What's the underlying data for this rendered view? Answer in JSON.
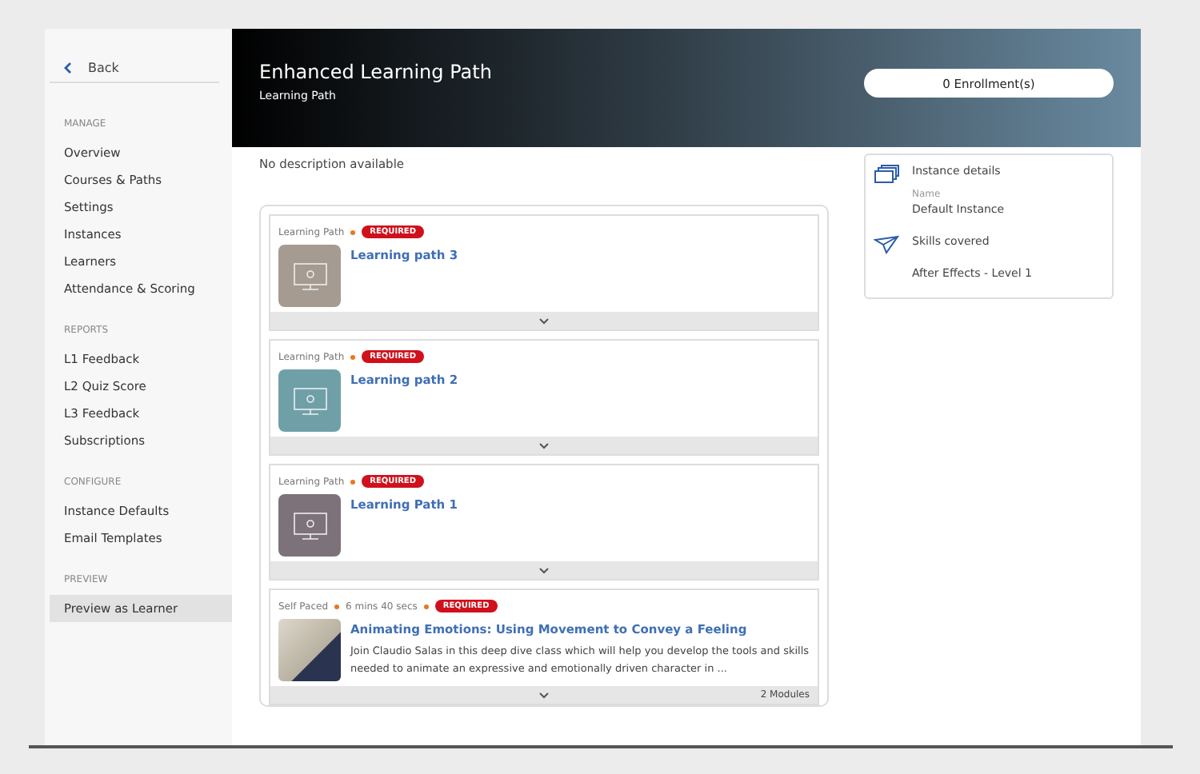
{
  "sidebar": {
    "back": "Back",
    "sections": [
      {
        "title": "MANAGE",
        "items": [
          {
            "label": "Overview",
            "selected": false
          },
          {
            "label": "Courses & Paths",
            "selected": false
          },
          {
            "label": "Settings",
            "selected": false
          },
          {
            "label": "Instances",
            "selected": false
          },
          {
            "label": "Learners",
            "selected": false
          },
          {
            "label": "Attendance & Scoring",
            "selected": false
          }
        ]
      },
      {
        "title": "REPORTS",
        "items": [
          {
            "label": "L1 Feedback",
            "selected": false
          },
          {
            "label": "L2 Quiz Score",
            "selected": false
          },
          {
            "label": "L3 Feedback",
            "selected": false
          },
          {
            "label": "Subscriptions",
            "selected": false
          }
        ]
      },
      {
        "title": "CONFIGURE",
        "items": [
          {
            "label": "Instance Defaults",
            "selected": false
          },
          {
            "label": "Email Templates",
            "selected": false
          }
        ]
      },
      {
        "title": "PREVIEW",
        "items": [
          {
            "label": "Preview as Learner",
            "selected": true
          }
        ]
      }
    ]
  },
  "header": {
    "title": "Enhanced Learning Path",
    "subtitle": "Learning Path",
    "enrollments": "0 Enrollment(s)"
  },
  "description": "No description available",
  "items": [
    {
      "kind": "path",
      "type": "Learning Path",
      "badge": "REQUIRED",
      "title": "Learning path 3",
      "color": "#a59b90"
    },
    {
      "kind": "path",
      "type": "Learning Path",
      "badge": "REQUIRED",
      "title": "Learning path 2",
      "color": "#6fa0a8"
    },
    {
      "kind": "path",
      "type": "Learning Path",
      "badge": "REQUIRED",
      "title": "Learning Path 1",
      "color": "#7d727a"
    },
    {
      "kind": "course",
      "type": "Self Paced",
      "duration": "6 mins 40 secs",
      "badge": "REQUIRED",
      "title": "Animating Emotions: Using Movement to Convey a Feeling",
      "summary": "Join Claudio Salas in this deep dive class which will help you develop the tools and skills needed to animate an expressive and emotionally driven character in ...",
      "modules": "2 Modules"
    }
  ],
  "details": {
    "instance_heading": "Instance details",
    "name_label": "Name",
    "name_value": "Default Instance",
    "skills_heading": "Skills covered",
    "skill": "After Effects - Level 1"
  }
}
